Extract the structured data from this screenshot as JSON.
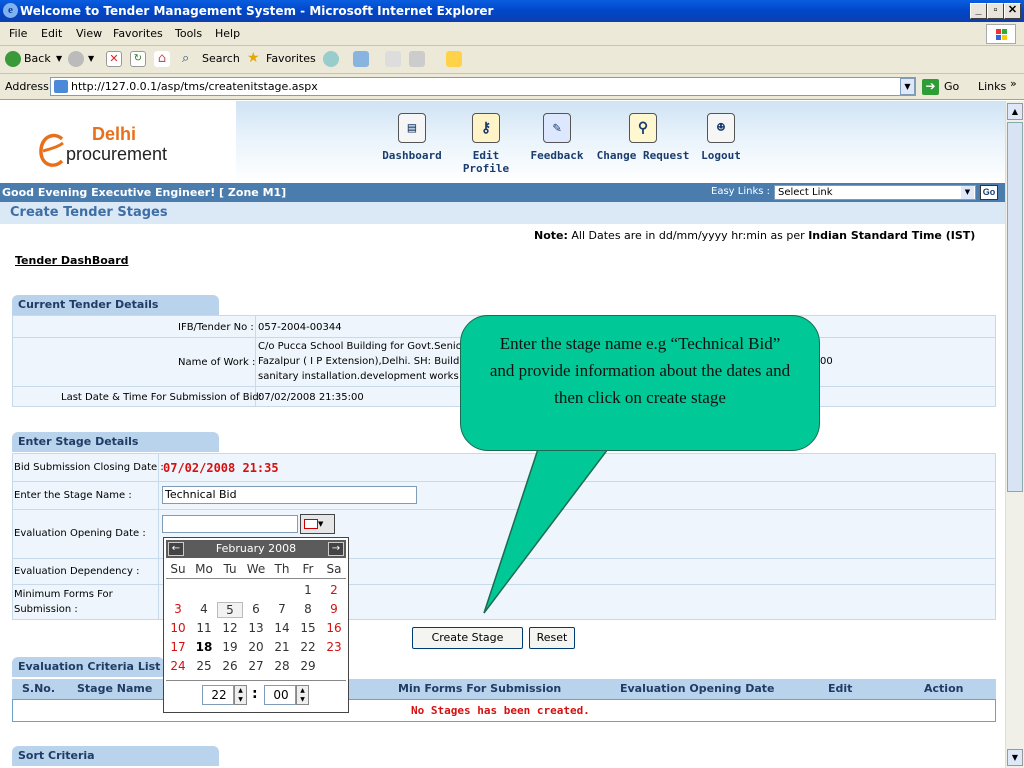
{
  "browser": {
    "title": "Welcome to Tender Management System - Microsoft Internet Explorer",
    "menu": [
      "File",
      "Edit",
      "View",
      "Favorites",
      "Tools",
      "Help"
    ],
    "toolbar": {
      "back": "Back",
      "search": "Search",
      "favorites": "Favorites"
    },
    "address_label": "Address",
    "url": "http://127.0.0.1/asp/tms/createnitstage.aspx",
    "go": "Go",
    "links": "Links"
  },
  "site": {
    "logo_line1": "Delhi",
    "logo_line2": "procurement",
    "nav": [
      "Dashboard",
      "Edit Profile",
      "Feedback",
      "Change Request",
      "Logout"
    ],
    "greeting": "Good Evening Executive Engineer!   [ Zone M1]",
    "easy_links_label": "Easy Links :",
    "easy_links_value": "Select Link",
    "go": "Go"
  },
  "page": {
    "title": "Create Tender Stages",
    "note_label": "Note:",
    "note_text": " All Dates are in dd/mm/yyyy hr:min as per ",
    "note_bold": "Indian Standard Time (IST)",
    "dashboard_link": "Tender DashBoard"
  },
  "current_tender": {
    "header": "Current Tender Details",
    "ifb_label": "IFB/Tender No :",
    "ifb_value": "057-2004-00344",
    "work_label": "Name of Work :",
    "work_value_line1": "C/o Pucca School Building for Govt.Senior",
    "work_value_line2": "Fazalpur ( I P Extension),Delhi. SH: Building",
    "work_value_line3": "sanitary installation.development works ar",
    "work_trailing": "00",
    "last_date_label": "Last Date & Time For Submission of Bid:",
    "last_date_value": "07/02/2008 21:35:00"
  },
  "stage": {
    "header": "Enter Stage Details",
    "closing_label": "Bid Submission Closing Date :",
    "closing_value": "07/02/2008 21:35",
    "name_label": "Enter the Stage Name :",
    "name_value": "Technical Bid",
    "eval_open_label": "Evaluation Opening Date :",
    "eval_open_value": "",
    "eval_dep_label": "Evaluation Dependency :",
    "min_forms_label_1": "Minimum Forms For",
    "min_forms_label_2": "Submission :",
    "create_button": "Create Stage",
    "reset_button": "Reset"
  },
  "calendar": {
    "month": "February 2008",
    "prev": "←",
    "next": "→",
    "days": [
      "Su",
      "Mo",
      "Tu",
      "We",
      "Th",
      "Fr",
      "Sa"
    ],
    "weeks": [
      [
        "",
        "",
        "",
        "",
        "",
        "1",
        "2"
      ],
      [
        "3",
        "4",
        "5",
        "6",
        "7",
        "8",
        "9"
      ],
      [
        "10",
        "11",
        "12",
        "13",
        "14",
        "15",
        "16"
      ],
      [
        "17",
        "18",
        "19",
        "20",
        "21",
        "22",
        "23"
      ],
      [
        "24",
        "25",
        "26",
        "27",
        "28",
        "29",
        ""
      ]
    ],
    "hour": "22",
    "minute": "00",
    "separator": ":",
    "weekend_color": "#d41010"
  },
  "criteria": {
    "header": "Evaluation Criteria List",
    "columns": [
      "S.No.",
      "Stage Name",
      "Min Forms For Submission",
      "Evaluation Opening Date",
      "Edit",
      "Action"
    ],
    "empty_message": "No Stages has been created."
  },
  "sort": {
    "header": "Sort Criteria"
  },
  "callout": {
    "text": "Enter the stage name e.g “Technical Bid” and provide information about the dates and then click on create stage"
  }
}
